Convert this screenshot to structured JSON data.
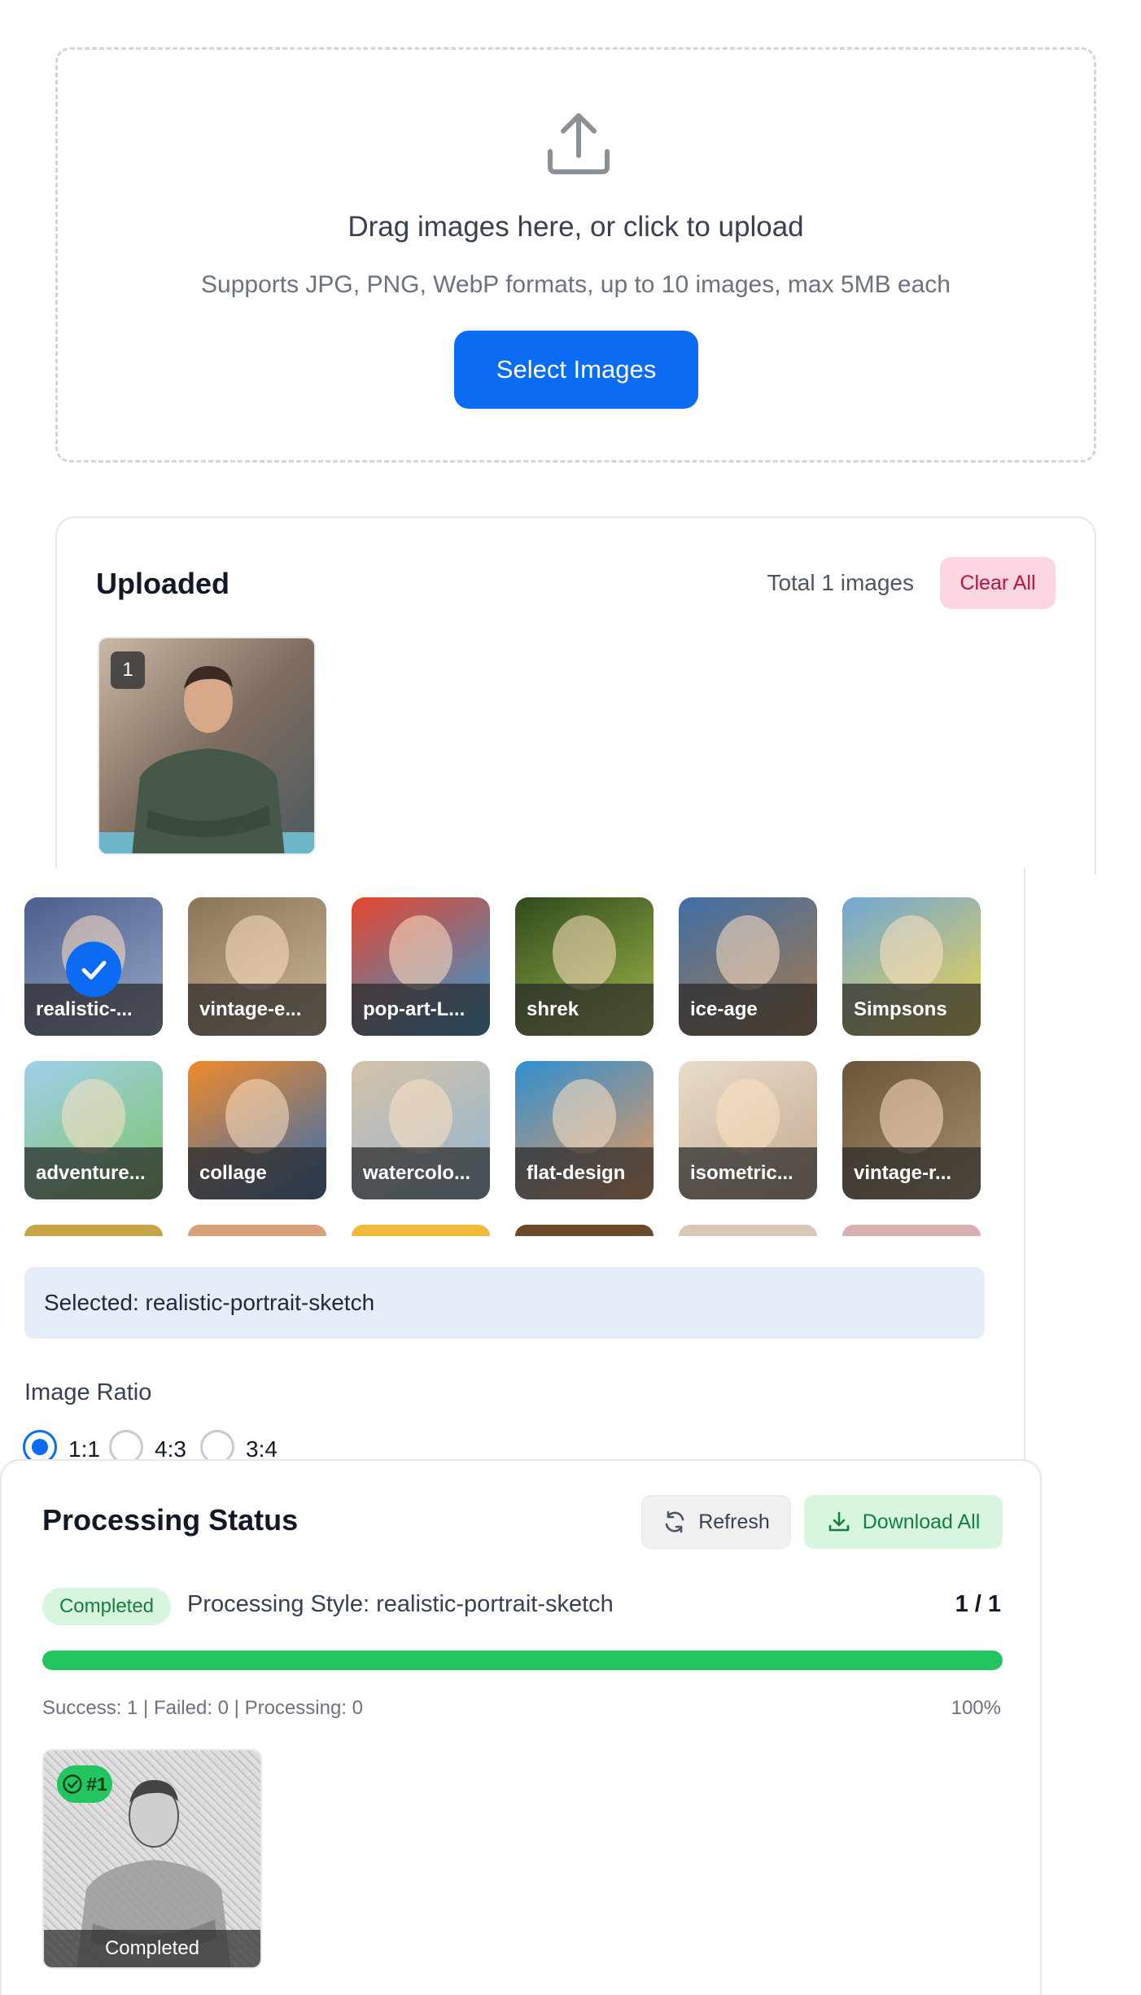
{
  "upload": {
    "icon": "upload-icon",
    "title": "Drag images here, or click to upload",
    "subtitle": "Supports JPG, PNG, WebP formats, up to 10 images, max 5MB each",
    "button_label": "Select Images"
  },
  "uploaded": {
    "title": "Uploaded",
    "total_label": "Total 1 images",
    "clear_label": "Clear All",
    "images": [
      {
        "index": "1"
      }
    ]
  },
  "styles": {
    "cards": [
      {
        "label": "realistic-...",
        "selected": true,
        "colors": [
          "#4b5e8c",
          "#9aa8c9"
        ]
      },
      {
        "label": "vintage-e...",
        "selected": false,
        "colors": [
          "#8a7456",
          "#cdb896"
        ]
      },
      {
        "label": "pop-art-L...",
        "selected": false,
        "colors": [
          "#e6462f",
          "#2a9bd8"
        ]
      },
      {
        "label": "shrek",
        "selected": false,
        "colors": [
          "#2f4a1c",
          "#a0b84a"
        ]
      },
      {
        "label": "ice-age",
        "selected": false,
        "colors": [
          "#3f6ea6",
          "#a97a4a"
        ]
      },
      {
        "label": "Simpsons",
        "selected": false,
        "colors": [
          "#6fa7d6",
          "#f2d34a"
        ]
      },
      {
        "label": "adventure...",
        "selected": false,
        "colors": [
          "#9fd0ec",
          "#7cc466"
        ]
      },
      {
        "label": "collage",
        "selected": false,
        "colors": [
          "#f08a2a",
          "#2e6cb8"
        ]
      },
      {
        "label": "watercolo...",
        "selected": false,
        "colors": [
          "#d6c2a8",
          "#8fb6d2"
        ]
      },
      {
        "label": "flat-design",
        "selected": false,
        "colors": [
          "#2f8fd1",
          "#f29a58"
        ]
      },
      {
        "label": "isometric...",
        "selected": false,
        "colors": [
          "#e8dccc",
          "#c2a98c"
        ]
      },
      {
        "label": "vintage-r...",
        "selected": false,
        "colors": [
          "#6b5438",
          "#a89070"
        ]
      }
    ],
    "partial_colors": [
      "#c9a446",
      "#d9a27a",
      "#f2b93a",
      "#6b4a2a",
      "#d9c8b8",
      "#d8b0b0"
    ],
    "selected_text": "Selected: realistic-portrait-sketch"
  },
  "ratio": {
    "title": "Image Ratio",
    "options": [
      {
        "label": "1:1",
        "checked": true
      },
      {
        "label": "4:3",
        "checked": false
      },
      {
        "label": "3:4",
        "checked": false
      }
    ]
  },
  "status": {
    "title": "Processing Status",
    "refresh_label": "Refresh",
    "refresh_icon": "refresh-icon",
    "download_label": "Download All",
    "download_icon": "download-icon",
    "badge": "Completed",
    "style_text": "Processing Style: realistic-portrait-sketch",
    "count": "1 / 1",
    "progress": 1.0,
    "stats": "Success: 1 | Failed: 0 | Processing: 0",
    "percent": "100%",
    "results": [
      {
        "badge": "#1",
        "label": "Completed"
      }
    ]
  },
  "colors": {
    "primary": "#0b6bf2",
    "success": "#22c55e",
    "danger_bg": "#fcd6e1",
    "selected_bg": "#e5edfb"
  }
}
